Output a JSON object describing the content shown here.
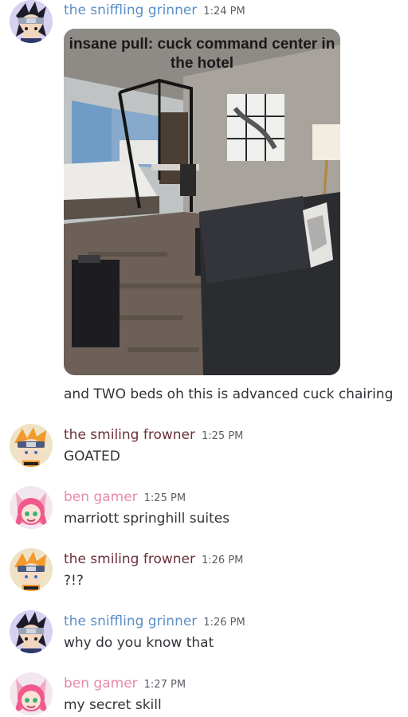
{
  "colors": {
    "sniffling_grinner": "#5b8fc7",
    "smiling_frowner": "#6b2f3a",
    "ben_gamer": "#e88aa6"
  },
  "messages": [
    {
      "user": "the sniffling grinner",
      "time": "1:24 PM",
      "avatar_icon": "ninja-avatar-icon",
      "attachment": {
        "caption": "insane pull: cuck command center in the hotel"
      },
      "text": "and TWO beds oh this is advanced cuck chairing"
    },
    {
      "user": "the smiling frowner",
      "time": "1:25 PM",
      "avatar_icon": "orange-ninja-avatar-icon",
      "text": "GOATED"
    },
    {
      "user": "ben gamer",
      "time": "1:25 PM",
      "avatar_icon": "pink-hair-avatar-icon",
      "text": "marriott springhill suites"
    },
    {
      "user": "the smiling frowner",
      "time": "1:26 PM",
      "avatar_icon": "orange-ninja-avatar-icon",
      "text": "?!?"
    },
    {
      "user": "the sniffling grinner",
      "time": "1:26 PM",
      "avatar_icon": "ninja-avatar-icon",
      "text": "why do you know that"
    },
    {
      "user": "ben gamer",
      "time": "1:27 PM",
      "avatar_icon": "pink-hair-avatar-icon",
      "text": "my secret skill"
    }
  ]
}
